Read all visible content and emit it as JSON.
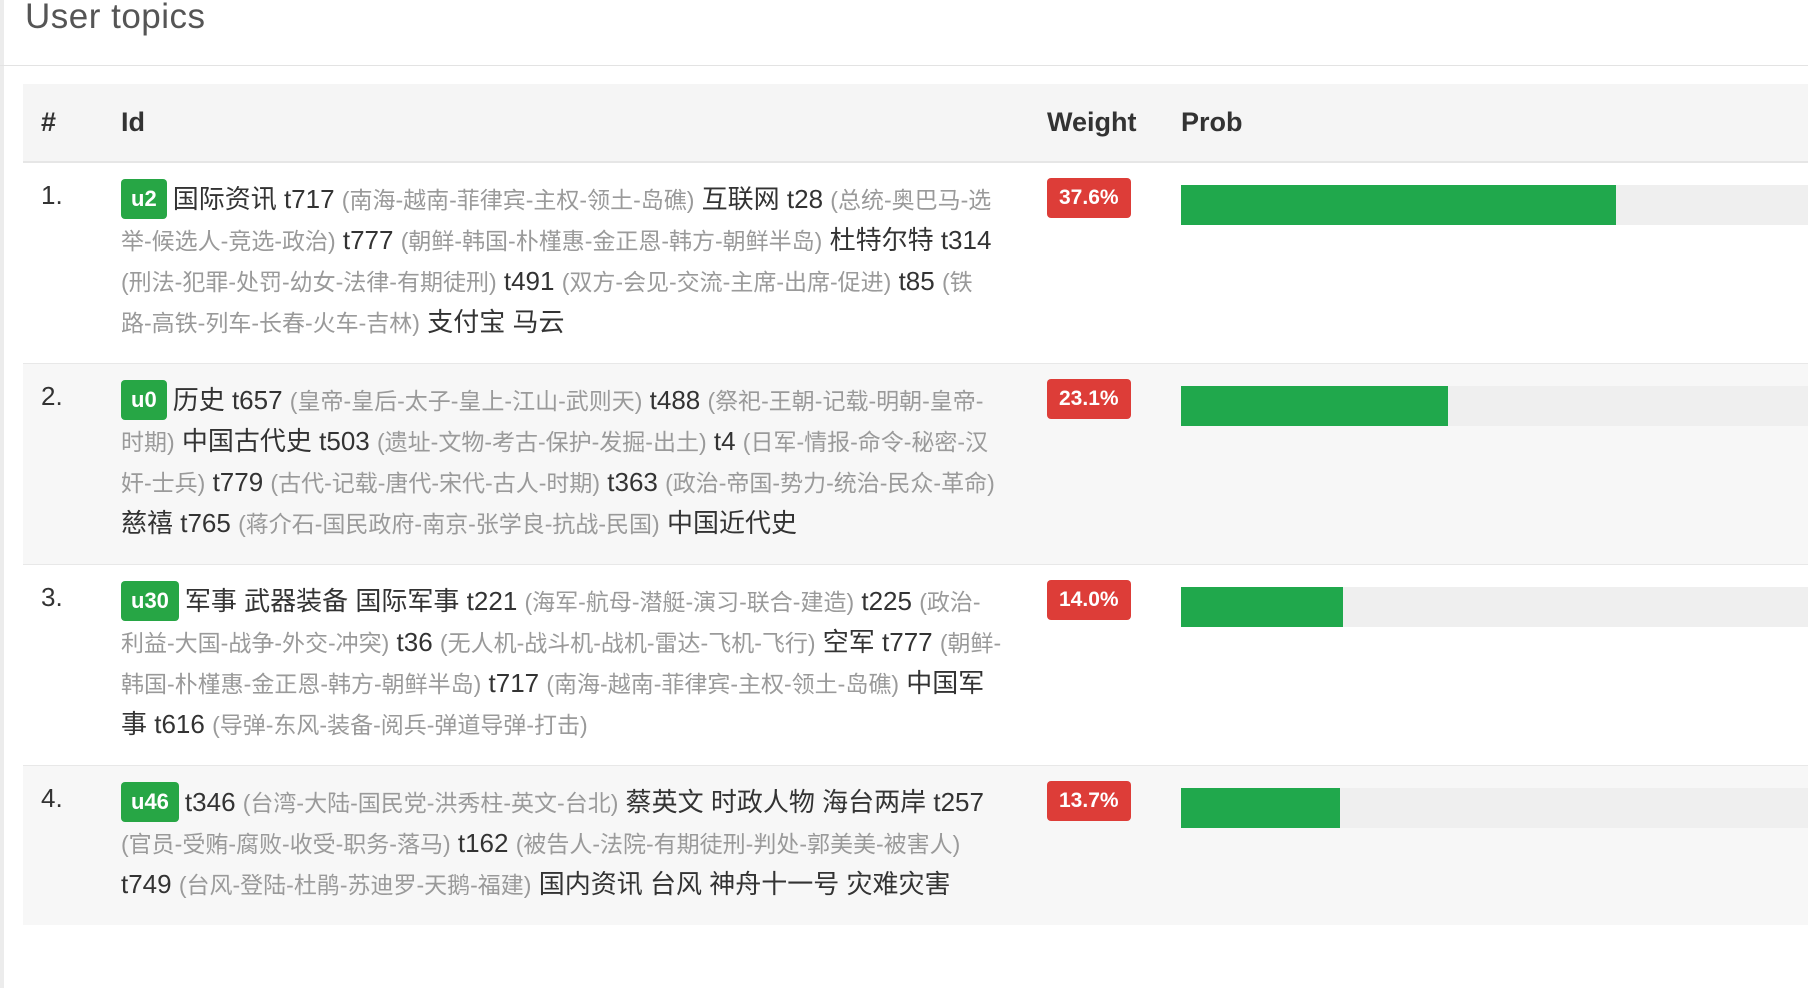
{
  "panel": {
    "title": "User topics"
  },
  "table": {
    "headers": {
      "num": "#",
      "id": "Id",
      "weight": "Weight",
      "prob": "Prob"
    },
    "rows": [
      {
        "rank": "1.",
        "user": "u2",
        "weight": "37.6%",
        "prob": 0.376,
        "items": [
          {
            "kind": "tag",
            "text": "国际资讯"
          },
          {
            "kind": "topic",
            "id": "t717",
            "words": "(南海-越南-菲律宾-主权-领土-岛礁)"
          },
          {
            "kind": "tag",
            "text": "互联网"
          },
          {
            "kind": "topic",
            "id": "t28",
            "words": "(总统-奥巴马-选举-候选人-竞选-政治)"
          },
          {
            "kind": "topic",
            "id": "t777",
            "words": "(朝鲜-韩国-朴槿惠-金正恩-韩方-朝鲜半岛)"
          },
          {
            "kind": "tag",
            "text": "杜特尔特"
          },
          {
            "kind": "topic",
            "id": "t314",
            "words": "(刑法-犯罪-处罚-幼女-法律-有期徒刑)"
          },
          {
            "kind": "topic",
            "id": "t491",
            "words": "(双方-会见-交流-主席-出席-促进)"
          },
          {
            "kind": "topic",
            "id": "t85",
            "words": "(铁路-高铁-列车-长春-火车-吉林)"
          },
          {
            "kind": "tag",
            "text": "支付宝"
          },
          {
            "kind": "tag",
            "text": "马云"
          }
        ]
      },
      {
        "rank": "2.",
        "user": "u0",
        "weight": "23.1%",
        "prob": 0.231,
        "items": [
          {
            "kind": "tag",
            "text": "历史"
          },
          {
            "kind": "topic",
            "id": "t657",
            "words": "(皇帝-皇后-太子-皇上-江山-武则天)"
          },
          {
            "kind": "topic",
            "id": "t488",
            "words": "(祭祀-王朝-记载-明朝-皇帝-时期)"
          },
          {
            "kind": "tag",
            "text": "中国古代史"
          },
          {
            "kind": "topic",
            "id": "t503",
            "words": "(遗址-文物-考古-保护-发掘-出土)"
          },
          {
            "kind": "topic",
            "id": "t4",
            "words": "(日军-情报-命令-秘密-汉奸-士兵)"
          },
          {
            "kind": "topic",
            "id": "t779",
            "words": "(古代-记载-唐代-宋代-古人-时期)"
          },
          {
            "kind": "topic",
            "id": "t363",
            "words": "(政治-帝国-势力-统治-民众-革命)"
          },
          {
            "kind": "tag",
            "text": "慈禧"
          },
          {
            "kind": "topic",
            "id": "t765",
            "words": "(蒋介石-国民政府-南京-张学良-抗战-民国)"
          },
          {
            "kind": "tag",
            "text": "中国近代史"
          }
        ]
      },
      {
        "rank": "3.",
        "user": "u30",
        "weight": "14.0%",
        "prob": 0.14,
        "items": [
          {
            "kind": "tag",
            "text": "军事"
          },
          {
            "kind": "tag",
            "text": "武器装备"
          },
          {
            "kind": "tag",
            "text": "国际军事"
          },
          {
            "kind": "topic",
            "id": "t221",
            "words": "(海军-航母-潜艇-演习-联合-建造)"
          },
          {
            "kind": "topic",
            "id": "t225",
            "words": "(政治-利益-大国-战争-外交-冲突)"
          },
          {
            "kind": "topic",
            "id": "t36",
            "words": "(无人机-战斗机-战机-雷达-飞机-飞行)"
          },
          {
            "kind": "tag",
            "text": "空军"
          },
          {
            "kind": "topic",
            "id": "t777",
            "words": "(朝鲜-韩国-朴槿惠-金正恩-韩方-朝鲜半岛)"
          },
          {
            "kind": "topic",
            "id": "t717",
            "words": "(南海-越南-菲律宾-主权-领土-岛礁)"
          },
          {
            "kind": "tag",
            "text": "中国军事"
          },
          {
            "kind": "topic",
            "id": "t616",
            "words": "(导弹-东风-装备-阅兵-弹道导弹-打击)"
          }
        ]
      },
      {
        "rank": "4.",
        "user": "u46",
        "weight": "13.7%",
        "prob": 0.137,
        "items": [
          {
            "kind": "topic",
            "id": "t346",
            "words": "(台湾-大陆-国民党-洪秀柱-英文-台北)"
          },
          {
            "kind": "tag",
            "text": "蔡英文"
          },
          {
            "kind": "tag",
            "text": "时政人物"
          },
          {
            "kind": "tag",
            "text": "海台两岸"
          },
          {
            "kind": "topic",
            "id": "t257",
            "words": "(官员-受贿-腐败-收受-职务-落马)"
          },
          {
            "kind": "topic",
            "id": "t162",
            "words": "(被告人-法院-有期徒刑-判处-郭美美-被害人)"
          },
          {
            "kind": "topic",
            "id": "t749",
            "words": "(台风-登陆-杜鹃-苏迪罗-天鹅-福建)"
          },
          {
            "kind": "tag",
            "text": "国内资讯"
          },
          {
            "kind": "tag",
            "text": "台风"
          },
          {
            "kind": "tag",
            "text": "神舟十一号"
          },
          {
            "kind": "tag",
            "text": "灾难灾害"
          }
        ]
      }
    ]
  },
  "colors": {
    "user_label": "#27a645",
    "weight_badge": "#dd3d38",
    "prob_bar": "#20a84c",
    "topic_words": "#9a9a9a"
  }
}
